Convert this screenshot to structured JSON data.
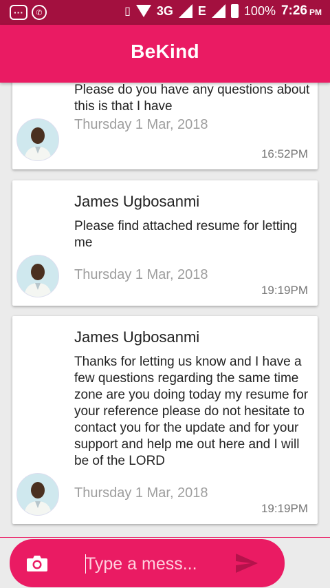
{
  "status_bar": {
    "network": "3G",
    "edge": "E",
    "battery": "100%",
    "time": "7:26",
    "ampm": "PM"
  },
  "app_bar": {
    "title": "BeKind"
  },
  "messages": [
    {
      "sender": "",
      "text": "Please do you have any questions about this is that I have",
      "date": "Thursday 1 Mar, 2018",
      "time": "16:52PM"
    },
    {
      "sender": "James Ugbosanmi",
      "text": "Please find attached resume for letting me",
      "date": "Thursday 1 Mar, 2018",
      "time": "19:19PM"
    },
    {
      "sender": "James Ugbosanmi",
      "text": "Thanks for letting us know and I have a few questions regarding the same time zone are you doing today my resume for your reference please do not hesitate to contact you for the update and for your support and help me out here and I will be of the LORD",
      "date": "Thursday 1 Mar, 2018",
      "time": "19:19PM"
    }
  ],
  "composer": {
    "placeholder": "Type a mess...",
    "camera_icon": "camera-icon",
    "send_icon": "send-icon"
  },
  "colors": {
    "primary": "#ea1b63",
    "status_bar": "#a3103f",
    "background": "#ebebeb"
  }
}
